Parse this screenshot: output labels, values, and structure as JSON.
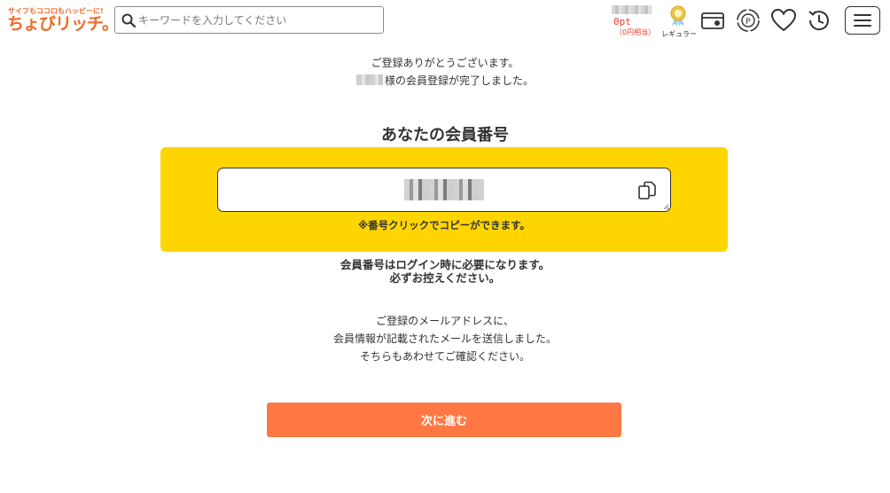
{
  "header": {
    "logo": {
      "tagline": "サイフもココロもハッピーに!",
      "brand": "ちょびリッチ。"
    },
    "search": {
      "placeholder": "キーワードを入力してください",
      "icon": "search-icon"
    },
    "points": {
      "value": "0pt",
      "yen_equivalent": "（0円相当）"
    },
    "rank": {
      "label": "レギュラー",
      "icon": "rank-medal-icon"
    },
    "icons": [
      "passbook-icon",
      "point-exchange-icon",
      "favorite-heart-icon",
      "history-icon",
      "hamburger-menu-icon"
    ]
  },
  "main": {
    "thanks_line1": "ご登録ありがとうございます。",
    "thanks_line2": "様の会員登録が完了しました。",
    "member_number_heading": "あなたの会員番号",
    "copy_note": "※番号クリックでコピーができます。",
    "notice_bold_line1": "会員番号はログイン時に必要になります。",
    "notice_bold_line2": "必ずお控えください。",
    "mail_line1": "ご登録のメールアドレスに、",
    "mail_line2": "会員情報が記載されたメールを送信しました。",
    "mail_line3": "そちらもあわせてご確認ください。",
    "next_button_label": "次に進む"
  },
  "colors": {
    "brand_orange": "#f06a28",
    "yellow_box": "#ffd500",
    "next_button": "#ff7742",
    "points_red": "#e53a2a"
  }
}
